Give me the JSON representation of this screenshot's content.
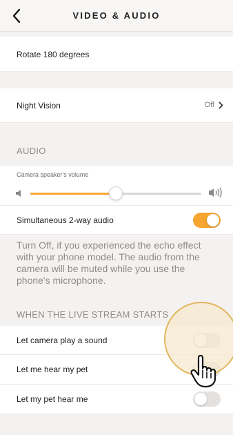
{
  "header": {
    "title": "VIDEO & AUDIO",
    "back_icon": "chevron-left-icon"
  },
  "settings": {
    "rotate": {
      "label": "Rotate 180 degrees"
    },
    "night_vision": {
      "label": "Night Vision",
      "value": "Off"
    }
  },
  "audio": {
    "section_title": "AUDIO",
    "volume": {
      "label": "Camera speaker's volume",
      "value_fraction": 0.5,
      "min_icon": "speaker-low-icon",
      "max_icon": "speaker-high-icon"
    },
    "two_way": {
      "label": "Simultaneous 2-way audio",
      "enabled": true
    },
    "note": "Turn Off, if you experienced the echo effect with your phone model. The audio from the camera will be muted while you use the phone's microphone."
  },
  "live_stream": {
    "section_title": "WHEN THE LIVE STREAM STARTS",
    "items": [
      {
        "label": "Let camera play a sound",
        "enabled": false
      },
      {
        "label": "Let me hear my pet",
        "enabled": false
      },
      {
        "label": "Let my pet hear me",
        "enabled": false
      }
    ]
  },
  "colors": {
    "accent": "#f7a531",
    "background": "#f4f2f1",
    "muted_text": "#8f8b88"
  },
  "overlay": {
    "pointer_icon": "hand-pointer-icon"
  }
}
